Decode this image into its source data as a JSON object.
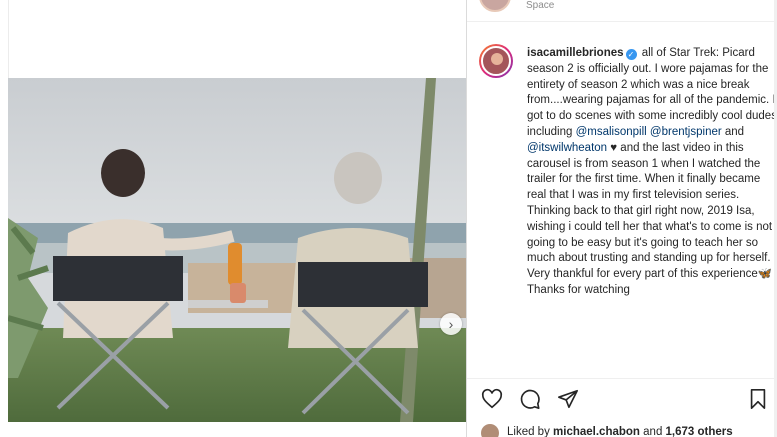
{
  "previous_comment": {
    "text": "Space"
  },
  "post": {
    "username": "isacamillebriones",
    "verified_symbol": "✓",
    "caption_parts": [
      "all of Star Trek: Picard season 2 is officially out. I wore pajamas for the entirety of season 2 which was a nice break from....wearing pajamas for all of the pandemic. I got to do scenes with some incredibly cool dudes including ",
      "@msalisonpill",
      " ",
      "@brentjspiner",
      " and ",
      "@itswilwheaton",
      " ♥ and the last video in this carousel is from season 1 when I watched the trailer for the first time. When it finally became real that I was in my first television series. Thinking back to that girl right now, 2019 Isa, wishing i could tell her that what's to come is not going to be easy but it's going to teach her so much about trusting and standing up for herself. Very thankful for every part of this experience🦋 Thanks for watching"
    ]
  },
  "likes": {
    "prefix": "Liked by ",
    "user": "michael.chabon",
    "middle": " and ",
    "count": "1,673 others"
  },
  "icons": {
    "like": "heart-icon",
    "comment": "comment-icon",
    "share": "share-icon",
    "save": "bookmark-icon",
    "next": "chevron-right-icon"
  },
  "colors": {
    "mention": "#00376b",
    "verified": "#3897f0"
  }
}
